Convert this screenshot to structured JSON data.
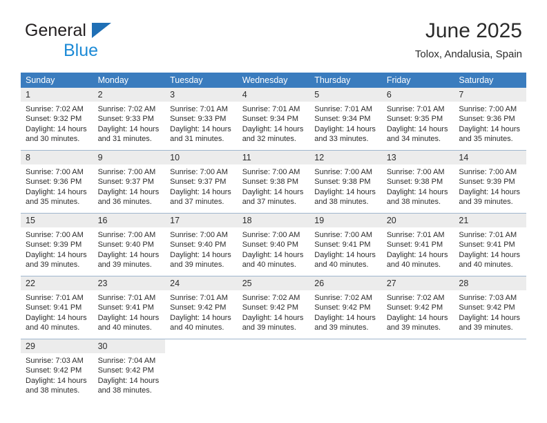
{
  "brand": {
    "name_top": "General",
    "name_bottom": "Blue",
    "logo_icon": "blue-triangle-icon"
  },
  "header": {
    "title": "June 2025",
    "subtitle": "Tolox, Andalusia, Spain"
  },
  "colors": {
    "header_blue": "#3a7cbe",
    "brand_blue": "#1c8ad6",
    "daynum_gray": "#ececec",
    "row_divider": "#9fb6cd",
    "text": "#2b2b2b"
  },
  "weekdays": [
    "Sunday",
    "Monday",
    "Tuesday",
    "Wednesday",
    "Thursday",
    "Friday",
    "Saturday"
  ],
  "weeks": [
    [
      {
        "day": "1",
        "sunrise": "Sunrise: 7:02 AM",
        "sunset": "Sunset: 9:32 PM",
        "daylight1": "Daylight: 14 hours",
        "daylight2": "and 30 minutes."
      },
      {
        "day": "2",
        "sunrise": "Sunrise: 7:02 AM",
        "sunset": "Sunset: 9:33 PM",
        "daylight1": "Daylight: 14 hours",
        "daylight2": "and 31 minutes."
      },
      {
        "day": "3",
        "sunrise": "Sunrise: 7:01 AM",
        "sunset": "Sunset: 9:33 PM",
        "daylight1": "Daylight: 14 hours",
        "daylight2": "and 31 minutes."
      },
      {
        "day": "4",
        "sunrise": "Sunrise: 7:01 AM",
        "sunset": "Sunset: 9:34 PM",
        "daylight1": "Daylight: 14 hours",
        "daylight2": "and 32 minutes."
      },
      {
        "day": "5",
        "sunrise": "Sunrise: 7:01 AM",
        "sunset": "Sunset: 9:34 PM",
        "daylight1": "Daylight: 14 hours",
        "daylight2": "and 33 minutes."
      },
      {
        "day": "6",
        "sunrise": "Sunrise: 7:01 AM",
        "sunset": "Sunset: 9:35 PM",
        "daylight1": "Daylight: 14 hours",
        "daylight2": "and 34 minutes."
      },
      {
        "day": "7",
        "sunrise": "Sunrise: 7:00 AM",
        "sunset": "Sunset: 9:36 PM",
        "daylight1": "Daylight: 14 hours",
        "daylight2": "and 35 minutes."
      }
    ],
    [
      {
        "day": "8",
        "sunrise": "Sunrise: 7:00 AM",
        "sunset": "Sunset: 9:36 PM",
        "daylight1": "Daylight: 14 hours",
        "daylight2": "and 35 minutes."
      },
      {
        "day": "9",
        "sunrise": "Sunrise: 7:00 AM",
        "sunset": "Sunset: 9:37 PM",
        "daylight1": "Daylight: 14 hours",
        "daylight2": "and 36 minutes."
      },
      {
        "day": "10",
        "sunrise": "Sunrise: 7:00 AM",
        "sunset": "Sunset: 9:37 PM",
        "daylight1": "Daylight: 14 hours",
        "daylight2": "and 37 minutes."
      },
      {
        "day": "11",
        "sunrise": "Sunrise: 7:00 AM",
        "sunset": "Sunset: 9:38 PM",
        "daylight1": "Daylight: 14 hours",
        "daylight2": "and 37 minutes."
      },
      {
        "day": "12",
        "sunrise": "Sunrise: 7:00 AM",
        "sunset": "Sunset: 9:38 PM",
        "daylight1": "Daylight: 14 hours",
        "daylight2": "and 38 minutes."
      },
      {
        "day": "13",
        "sunrise": "Sunrise: 7:00 AM",
        "sunset": "Sunset: 9:38 PM",
        "daylight1": "Daylight: 14 hours",
        "daylight2": "and 38 minutes."
      },
      {
        "day": "14",
        "sunrise": "Sunrise: 7:00 AM",
        "sunset": "Sunset: 9:39 PM",
        "daylight1": "Daylight: 14 hours",
        "daylight2": "and 39 minutes."
      }
    ],
    [
      {
        "day": "15",
        "sunrise": "Sunrise: 7:00 AM",
        "sunset": "Sunset: 9:39 PM",
        "daylight1": "Daylight: 14 hours",
        "daylight2": "and 39 minutes."
      },
      {
        "day": "16",
        "sunrise": "Sunrise: 7:00 AM",
        "sunset": "Sunset: 9:40 PM",
        "daylight1": "Daylight: 14 hours",
        "daylight2": "and 39 minutes."
      },
      {
        "day": "17",
        "sunrise": "Sunrise: 7:00 AM",
        "sunset": "Sunset: 9:40 PM",
        "daylight1": "Daylight: 14 hours",
        "daylight2": "and 39 minutes."
      },
      {
        "day": "18",
        "sunrise": "Sunrise: 7:00 AM",
        "sunset": "Sunset: 9:40 PM",
        "daylight1": "Daylight: 14 hours",
        "daylight2": "and 40 minutes."
      },
      {
        "day": "19",
        "sunrise": "Sunrise: 7:00 AM",
        "sunset": "Sunset: 9:41 PM",
        "daylight1": "Daylight: 14 hours",
        "daylight2": "and 40 minutes."
      },
      {
        "day": "20",
        "sunrise": "Sunrise: 7:01 AM",
        "sunset": "Sunset: 9:41 PM",
        "daylight1": "Daylight: 14 hours",
        "daylight2": "and 40 minutes."
      },
      {
        "day": "21",
        "sunrise": "Sunrise: 7:01 AM",
        "sunset": "Sunset: 9:41 PM",
        "daylight1": "Daylight: 14 hours",
        "daylight2": "and 40 minutes."
      }
    ],
    [
      {
        "day": "22",
        "sunrise": "Sunrise: 7:01 AM",
        "sunset": "Sunset: 9:41 PM",
        "daylight1": "Daylight: 14 hours",
        "daylight2": "and 40 minutes."
      },
      {
        "day": "23",
        "sunrise": "Sunrise: 7:01 AM",
        "sunset": "Sunset: 9:41 PM",
        "daylight1": "Daylight: 14 hours",
        "daylight2": "and 40 minutes."
      },
      {
        "day": "24",
        "sunrise": "Sunrise: 7:01 AM",
        "sunset": "Sunset: 9:42 PM",
        "daylight1": "Daylight: 14 hours",
        "daylight2": "and 40 minutes."
      },
      {
        "day": "25",
        "sunrise": "Sunrise: 7:02 AM",
        "sunset": "Sunset: 9:42 PM",
        "daylight1": "Daylight: 14 hours",
        "daylight2": "and 39 minutes."
      },
      {
        "day": "26",
        "sunrise": "Sunrise: 7:02 AM",
        "sunset": "Sunset: 9:42 PM",
        "daylight1": "Daylight: 14 hours",
        "daylight2": "and 39 minutes."
      },
      {
        "day": "27",
        "sunrise": "Sunrise: 7:02 AM",
        "sunset": "Sunset: 9:42 PM",
        "daylight1": "Daylight: 14 hours",
        "daylight2": "and 39 minutes."
      },
      {
        "day": "28",
        "sunrise": "Sunrise: 7:03 AM",
        "sunset": "Sunset: 9:42 PM",
        "daylight1": "Daylight: 14 hours",
        "daylight2": "and 39 minutes."
      }
    ],
    [
      {
        "day": "29",
        "sunrise": "Sunrise: 7:03 AM",
        "sunset": "Sunset: 9:42 PM",
        "daylight1": "Daylight: 14 hours",
        "daylight2": "and 38 minutes."
      },
      {
        "day": "30",
        "sunrise": "Sunrise: 7:04 AM",
        "sunset": "Sunset: 9:42 PM",
        "daylight1": "Daylight: 14 hours",
        "daylight2": "and 38 minutes."
      },
      {
        "day": "",
        "sunrise": "",
        "sunset": "",
        "daylight1": "",
        "daylight2": ""
      },
      {
        "day": "",
        "sunrise": "",
        "sunset": "",
        "daylight1": "",
        "daylight2": ""
      },
      {
        "day": "",
        "sunrise": "",
        "sunset": "",
        "daylight1": "",
        "daylight2": ""
      },
      {
        "day": "",
        "sunrise": "",
        "sunset": "",
        "daylight1": "",
        "daylight2": ""
      },
      {
        "day": "",
        "sunrise": "",
        "sunset": "",
        "daylight1": "",
        "daylight2": ""
      }
    ]
  ]
}
